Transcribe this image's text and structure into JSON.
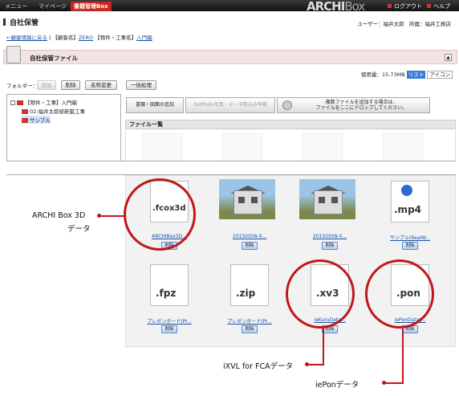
{
  "topbar": {
    "tabs": [
      "メニュー",
      "マイページ",
      "書籍管理Box"
    ],
    "logo_main": "ARCHI",
    "logo_box": "Box",
    "logout": "ログアウト",
    "help": "ヘルプ"
  },
  "header": {
    "title": "自社保管",
    "user": "ユーザー：福井太郎　所属：福井工務店"
  },
  "breadcrumb": {
    "back": "←顧客情報に戻る",
    "sep": "|",
    "client_label": "【顧客名】",
    "client": "ZERO",
    "property_label": "【物件・工事名】",
    "property": "入門編"
  },
  "panel": {
    "title": "自社保管ファイル",
    "collapse": "▲"
  },
  "usage": {
    "text": "使用量：15.73MB",
    "view_list": "リスト",
    "view_icon": "アイコン"
  },
  "folder": {
    "label": "フォルダー：",
    "add": "追加",
    "delete": "削除",
    "rename": "名称変更",
    "bulk": "一括処理"
  },
  "tree": {
    "items": [
      "【物件・工事】入門編",
      "02:福井太郎邸新築工事",
      "サンプル"
    ]
  },
  "actions": {
    "add_doc": "書類・図面の追加",
    "photo_apply": "DoPhoto写真・データ取込み申請",
    "drop_line1": "複数ファイルを追加する場合は、",
    "drop_line2": "ファイルをここにドロップしてください。"
  },
  "filelist": {
    "title": "ファイル一覧",
    "delete_label": "削除",
    "files": [
      {
        "ext": ".fcox3d",
        "name": "ARCHIBox3D..."
      },
      {
        "ext": "",
        "name": "20150508-0..."
      },
      {
        "ext": "",
        "name": "20150508-0..."
      },
      {
        "ext": ".mp4",
        "name": "サンプル(RealW..."
      },
      {
        "ext": ".fpz",
        "name": "プレゼンボード(Pr..."
      },
      {
        "ext": ".zip",
        "name": "プレゼンボード(Pr..."
      },
      {
        "ext": ".xv3",
        "name": "ieKuruData..."
      },
      {
        "ext": ".pon",
        "name": "iePonData(..."
      }
    ]
  },
  "annotations": {
    "archi3d_line1": "ARCHI Box 3D",
    "archi3d_line2": "データ",
    "ixvl": "iXVL for FCAデータ",
    "iepon": "iePonデータ"
  },
  "colors": {
    "accent": "#c0171b",
    "link": "#1a4fa8",
    "topbar": "#1e1e1e"
  }
}
